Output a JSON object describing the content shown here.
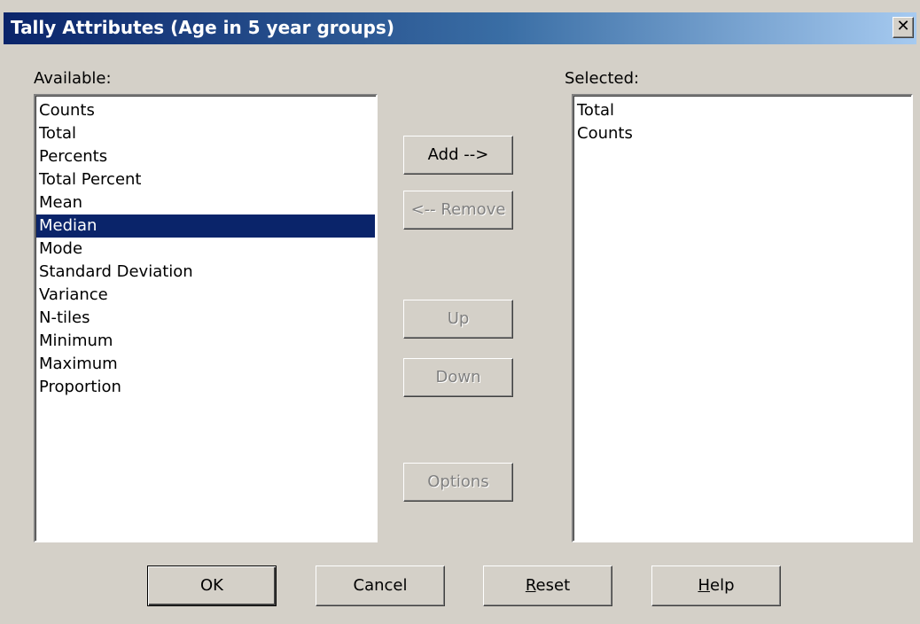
{
  "window": {
    "title": "Tally Attributes (Age in 5 year groups)",
    "close_glyph": "✕"
  },
  "available": {
    "label": "Available:",
    "items": [
      "Counts",
      "Total",
      "Percents",
      "Total Percent",
      "Mean",
      "Median",
      "Mode",
      "Standard Deviation",
      "Variance",
      "N-tiles",
      "Minimum",
      "Maximum",
      "Proportion"
    ],
    "selected_item": "Median"
  },
  "selected": {
    "label": "Selected:",
    "items": [
      "Total",
      "Counts"
    ]
  },
  "buttons": {
    "add": "Add -->",
    "remove": "<-- Remove",
    "up": "Up",
    "down": "Down",
    "options": "Options"
  },
  "footer": {
    "ok": "OK",
    "cancel": "Cancel",
    "reset_accel": "R",
    "reset_rest": "eset",
    "help_accel": "H",
    "help_rest": "elp"
  },
  "icons": {
    "close": "close-icon"
  },
  "colors": {
    "title_start": "#0a246a",
    "title_end": "#a6caf0",
    "face": "#d4d0c8",
    "selection": "#0a246a",
    "disabled_text": "#808080"
  }
}
